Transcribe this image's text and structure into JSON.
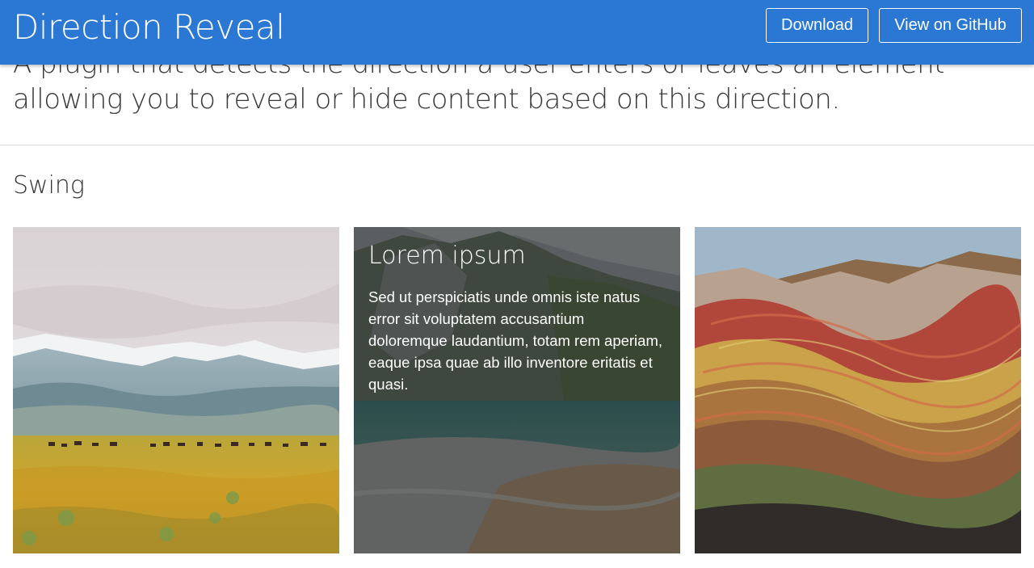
{
  "header": {
    "title": "Direction Reveal",
    "download_label": "Download",
    "github_label": "View on GitHub"
  },
  "intro": {
    "line1": "A plugin that detects the direction a user enters or leaves an element",
    "line2": "allowing you to reveal or hide content based on this direction."
  },
  "section": {
    "title": "Swing"
  },
  "tiles": [
    {},
    {
      "overlay_title": "Lorem ipsum",
      "overlay_text": "Sed ut perspiciatis unde omnis iste natus error sit voluptatem accusantium doloremque laudantium, totam rem aperiam, eaque ipsa quae ab illo inventore eritatis et quasi."
    },
    {}
  ],
  "colors": {
    "header_bg": "#2a78d3",
    "overlay": "rgba(40,40,40,0.55)"
  }
}
